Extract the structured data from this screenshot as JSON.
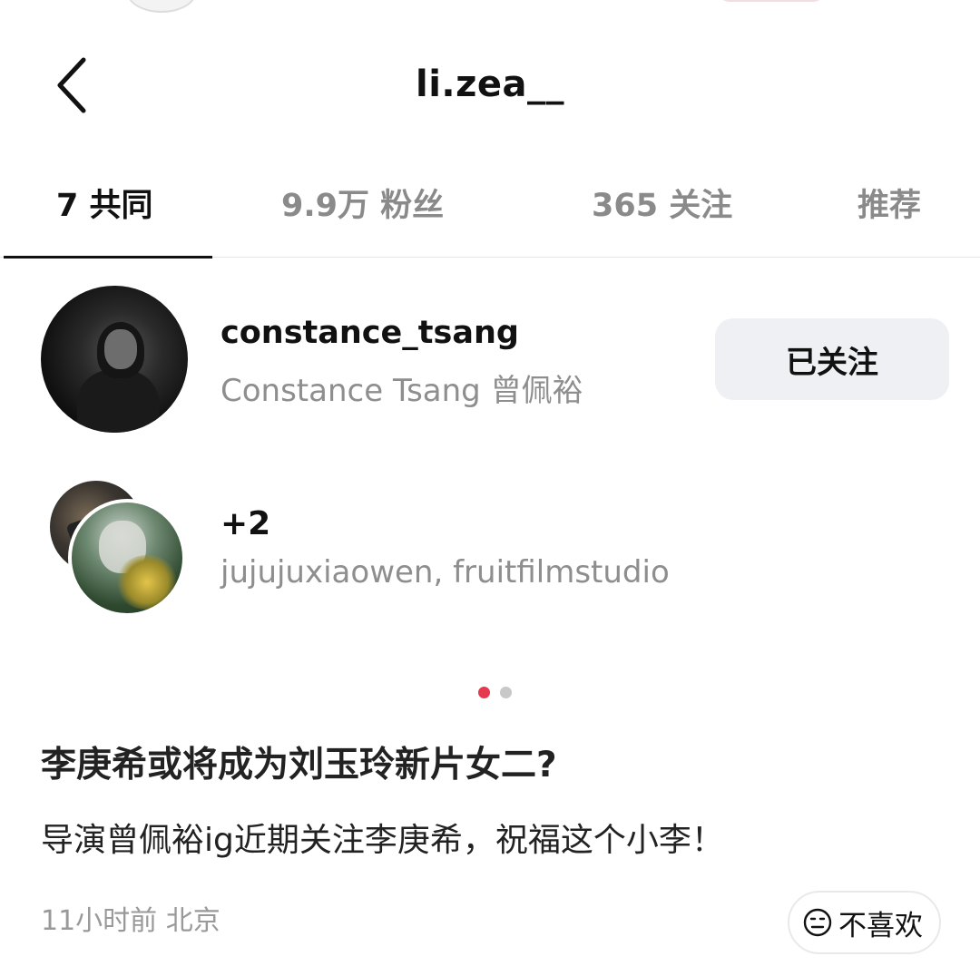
{
  "header": {
    "title": "li.zea__"
  },
  "tabs": [
    {
      "label": "7 共同",
      "active": true
    },
    {
      "label": "9.9万 粉丝",
      "active": false
    },
    {
      "label": "365 关注",
      "active": false
    },
    {
      "label": "推荐",
      "active": false
    }
  ],
  "mutual_users": [
    {
      "username": "constance_tsang",
      "full_name": "Constance Tsang 曾佩裕",
      "follow_label": "已关注"
    }
  ],
  "more_mutuals": {
    "count_label": "+2",
    "names": "jujujuxiaowen, fruitfilmstudio"
  },
  "carousel": {
    "count": 2,
    "active_index": 0
  },
  "post": {
    "title": "李庚希或将成为刘玉玲新片女二?",
    "body": "导演曾佩裕ig近期关注李庚希，祝福这个小李！",
    "meta": "11小时前 北京",
    "dislike_label": "不喜欢"
  },
  "colors": {
    "accent": "#e53950",
    "muted_text": "#8e8e8e",
    "button_bg": "#eef0f3"
  },
  "icons": {
    "back": "chevron-left-icon",
    "dislike": "neutral-face-icon"
  }
}
